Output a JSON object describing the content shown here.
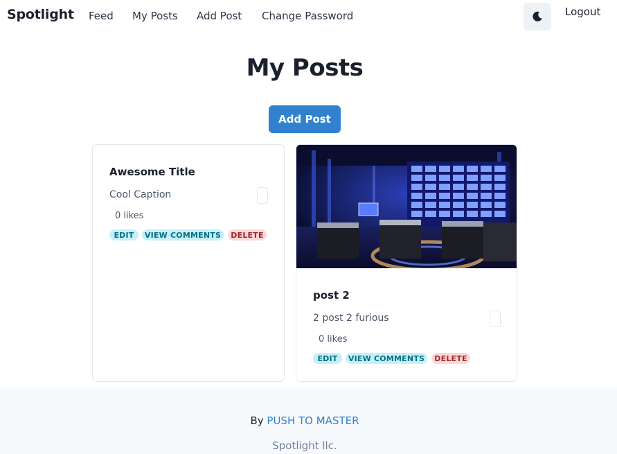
{
  "nav": {
    "brand": "Spotlight",
    "links": [
      "Feed",
      "My Posts",
      "Add Post",
      "Change Password"
    ],
    "logout": "Logout",
    "theme_icon": "moon-icon"
  },
  "main": {
    "title": "My Posts",
    "add_button": "Add Post"
  },
  "posts": [
    {
      "title": "Awesome Title",
      "caption": "Cool Caption",
      "likes": "0 likes",
      "has_image": false,
      "actions": {
        "edit": "EDIT",
        "view": "VIEW COMMENTS",
        "delete": "DELETE"
      }
    },
    {
      "title": "post 2",
      "caption": "2 post 2 furious",
      "likes": "0 likes",
      "has_image": true,
      "actions": {
        "edit": "EDIT",
        "view": "VIEW COMMENTS",
        "delete": "DELETE"
      }
    }
  ],
  "footer": {
    "by_prefix": "By",
    "by_link": "PUSH TO MASTER",
    "copy": "Spotlight llc."
  },
  "colors": {
    "accent": "#3182ce",
    "badge_teal": "#c4f1f9",
    "badge_red": "#fed7d7",
    "footer_bg": "#f7fafc"
  }
}
